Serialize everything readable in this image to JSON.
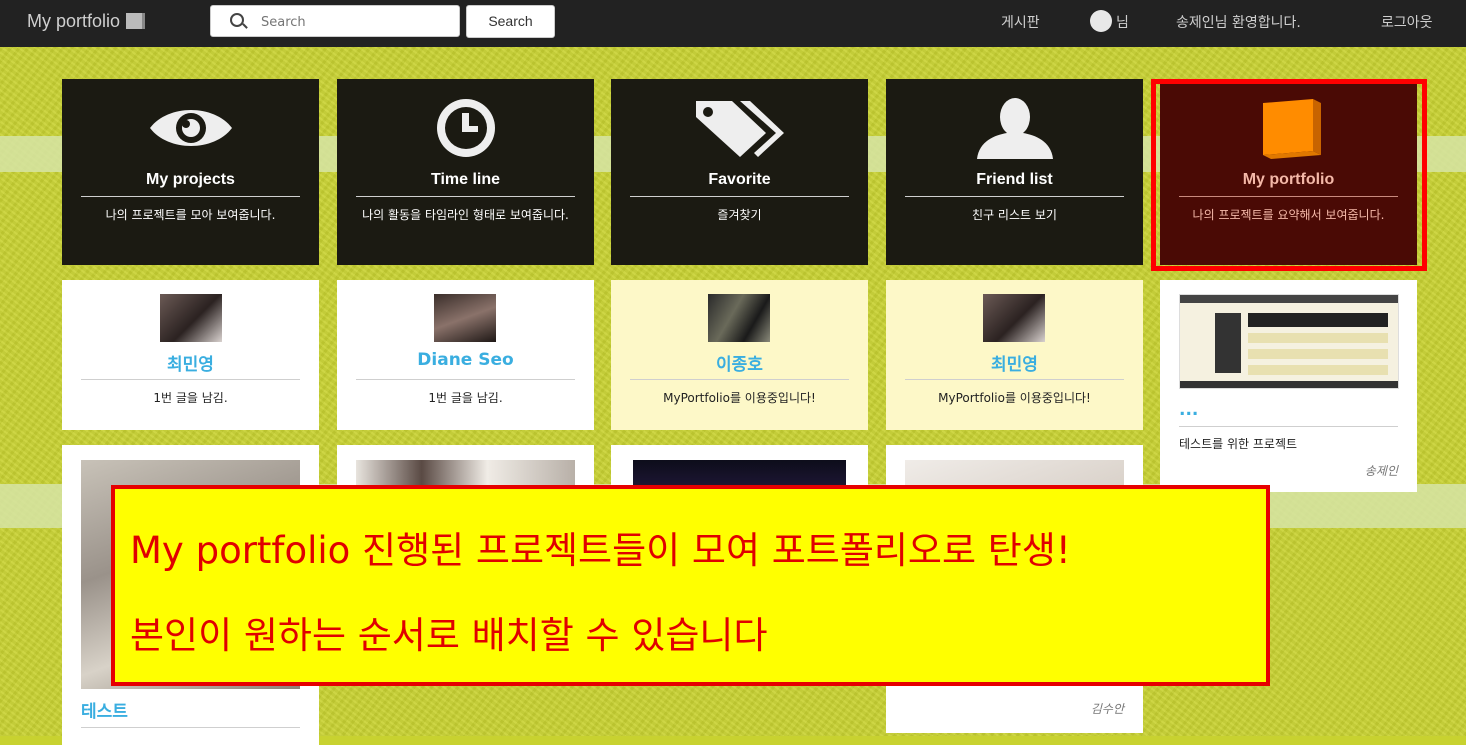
{
  "navbar": {
    "brand": "My portfolio",
    "search_placeholder": "Search",
    "search_button": "Search",
    "board_link": "게시판",
    "user_suffix": "님",
    "welcome": "송제인님 환영합니다.",
    "logout": "로그아웃"
  },
  "menu_tiles": [
    {
      "title": "My projects",
      "desc": "나의 프로젝트를 모아 보여줍니다.",
      "icon": "eye-icon"
    },
    {
      "title": "Time line",
      "desc": "나의 활동을 타임라인 형태로 보여줍니다.",
      "icon": "clock-icon"
    },
    {
      "title": "Favorite",
      "desc": "즐겨찾기",
      "icon": "tag-icon"
    },
    {
      "title": "Friend list",
      "desc": "친구 리스트 보기",
      "icon": "person-icon"
    },
    {
      "title": "My portfolio",
      "desc": "나의 프로젝트를 요약해서 보여줍니다.",
      "icon": "book-icon"
    }
  ],
  "user_tiles": [
    {
      "name": "최민영",
      "message": "1번 글을 남김."
    },
    {
      "name": "Diane Seo",
      "message": "1번 글을 남김."
    },
    {
      "name": "이종호",
      "message": "MyPortfolio를 이용중입니다!"
    },
    {
      "name": "최민영",
      "message": "MyPortfolio를 이용중입니다!"
    }
  ],
  "project_tiles": [
    {
      "title": "...",
      "desc": "테스트를 위한 프로젝트",
      "author": "송제인"
    },
    {
      "title": "테스트",
      "desc": "",
      "author": ""
    },
    {
      "title": "",
      "desc": "",
      "author": "김수안"
    }
  ],
  "callout": {
    "line1": "My portfolio 진행된 프로젝트들이 모여 포트폴리오로 탄생!",
    "line2": "본인이 원하는 순서로 배치할 수 있습니다"
  },
  "colors": {
    "accent_blue": "#3aaee0",
    "highlight_red": "#ff0000",
    "callout_yellow": "#ffff00",
    "portfolio_orange": "#ff8c00"
  }
}
